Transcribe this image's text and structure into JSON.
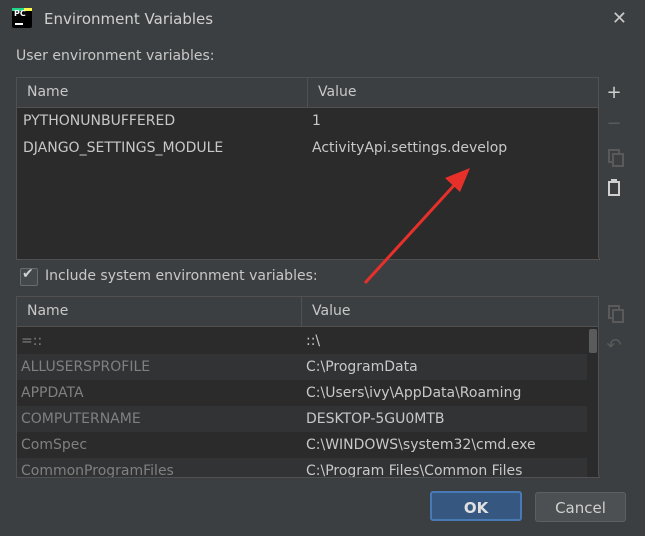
{
  "window": {
    "title": "Environment Variables",
    "app_icon_text": "PC",
    "close_icon": "close-icon"
  },
  "user_section": {
    "label": "User environment variables:",
    "columns": [
      "Name",
      "Value"
    ],
    "rows": [
      {
        "name": "PYTHONUNBUFFERED",
        "value": "1"
      },
      {
        "name": "DJANGO_SETTINGS_MODULE",
        "value": "ActivityApi.settings.develop"
      }
    ],
    "tools": [
      "add-icon",
      "remove-icon",
      "copy-icon",
      "paste-icon"
    ]
  },
  "include_system": {
    "label": "Include system environment variables:",
    "checked": true
  },
  "system_section": {
    "columns": [
      "Name",
      "Value"
    ],
    "rows": [
      {
        "name": "=::",
        "value": "::\\"
      },
      {
        "name": "ALLUSERSPROFILE",
        "value": "C:\\ProgramData"
      },
      {
        "name": "APPDATA",
        "value": "C:\\Users\\ivy\\AppData\\Roaming"
      },
      {
        "name": "COMPUTERNAME",
        "value": "DESKTOP-5GU0MTB"
      },
      {
        "name": "ComSpec",
        "value": "C:\\WINDOWS\\system32\\cmd.exe"
      },
      {
        "name": "CommonProgramFiles",
        "value": "C:\\Program Files\\Common Files"
      }
    ],
    "tools": [
      "copy-icon",
      "undo-icon"
    ]
  },
  "buttons": {
    "ok": "OK",
    "cancel": "Cancel"
  },
  "colors": {
    "background": "#3c3f41",
    "table_bg": "#2b2b2b",
    "accent": "#365880",
    "annotation_arrow": "#e8302a"
  }
}
